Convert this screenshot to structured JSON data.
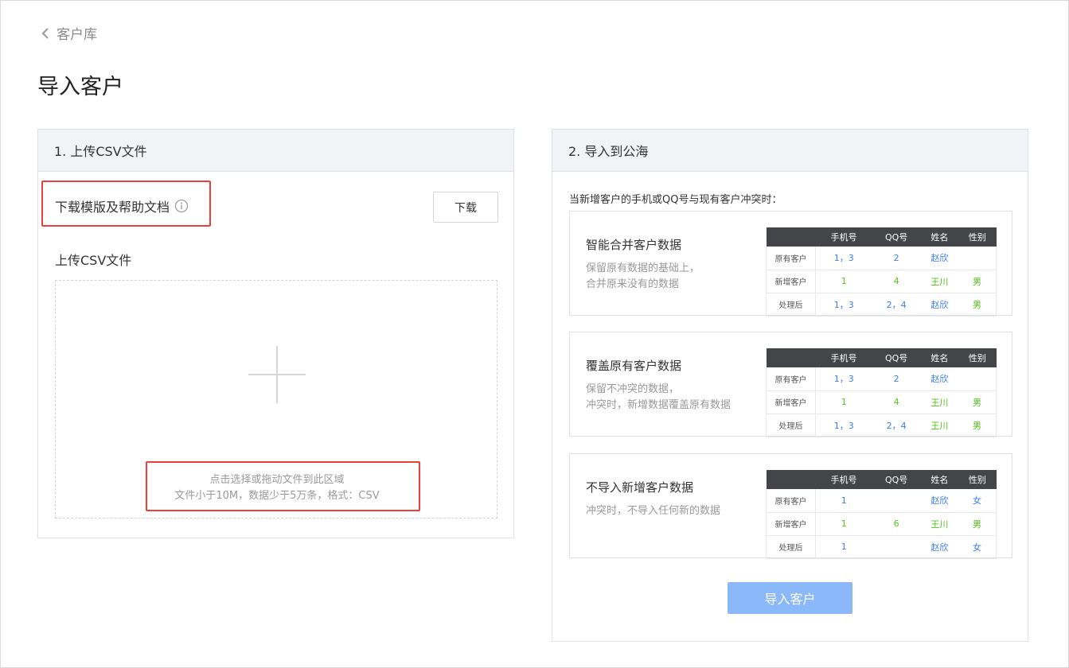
{
  "nav": {
    "back_label": "客户库"
  },
  "page": {
    "title": "导入客户"
  },
  "upload": {
    "header": "1. 上传CSV文件",
    "download_label": "下载模版及帮助文档",
    "download_button": "下载",
    "upload_label": "上传CSV文件",
    "drop_hint_1": "点击选择或拖动文件到此区域",
    "drop_hint_2": "文件小于10M，数据少于5万条，格式：CSV"
  },
  "import": {
    "header": "2. 导入到公海",
    "conflict_label": "当新增客户的手机或QQ号与现有客户冲突时：",
    "columns": [
      "",
      "手机号",
      "QQ号",
      "姓名",
      "性别"
    ],
    "options": [
      {
        "title": "智能合并客户数据",
        "desc_1": "保留原有数据的基础上，",
        "desc_2": "合并原来没有的数据",
        "rows": [
          [
            "原有客户",
            "1，3",
            "2",
            "赵欣",
            ""
          ],
          [
            "新增客户",
            "1",
            "4",
            "王川",
            "男"
          ],
          [
            "处理后",
            "1，3",
            "2，4",
            "赵欣",
            "男"
          ]
        ]
      },
      {
        "title": "覆盖原有客户数据",
        "desc_1": "保留不冲突的数据，",
        "desc_2": "冲突时，新增数据覆盖原有数据",
        "rows": [
          [
            "原有客户",
            "1，3",
            "2",
            "赵欣",
            ""
          ],
          [
            "新增客户",
            "1",
            "4",
            "王川",
            "男"
          ],
          [
            "处理后",
            "1，3",
            "2，4",
            "王川",
            "男"
          ]
        ]
      },
      {
        "title": "不导入新增客户数据",
        "desc_1": "冲突时，不导入任何新的数据",
        "desc_2": "",
        "rows": [
          [
            "原有客户",
            "1",
            "",
            "赵欣",
            "女"
          ],
          [
            "新增客户",
            "1",
            "6",
            "王川",
            "男"
          ],
          [
            "处理后",
            "1",
            "",
            "赵欣",
            "女"
          ]
        ]
      }
    ],
    "import_button": "导入客户"
  },
  "colors": {
    "primary": "#8ab8f8",
    "blue_text": "#3b7cf5",
    "green_text": "#52c41a",
    "highlight": "#e8403c"
  }
}
